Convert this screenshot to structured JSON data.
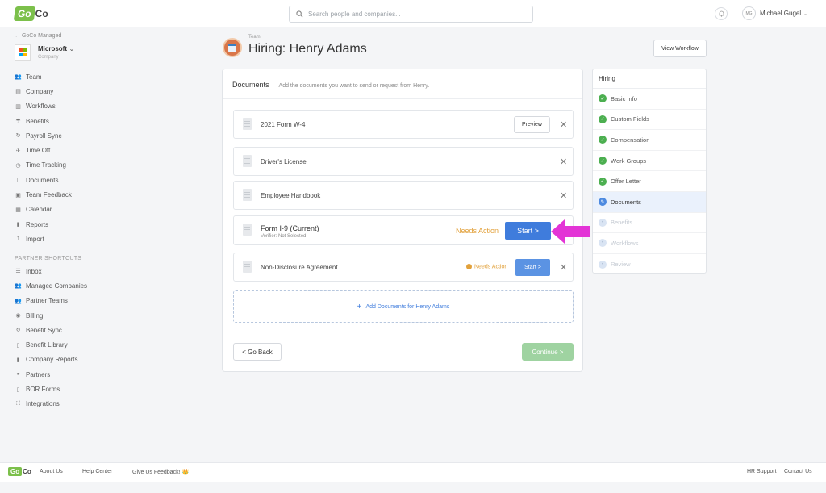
{
  "header": {
    "logo_go": "Go",
    "logo_co": "Co",
    "search_placeholder": "Search people and companies...",
    "user_initials": "MG",
    "user_name": "Michael Gugel"
  },
  "sidebar": {
    "back_label": "← GoCo Managed",
    "company_name": "Microsoft",
    "company_type": "Company",
    "items": [
      {
        "label": "Team",
        "icon": "people-icon"
      },
      {
        "label": "Company",
        "icon": "building-icon"
      },
      {
        "label": "Workflows",
        "icon": "workflow-icon"
      },
      {
        "label": "Benefits",
        "icon": "umbrella-icon"
      },
      {
        "label": "Payroll Sync",
        "icon": "sync-icon"
      },
      {
        "label": "Time Off",
        "icon": "plane-icon"
      },
      {
        "label": "Time Tracking",
        "icon": "clock-icon"
      },
      {
        "label": "Documents",
        "icon": "document-icon"
      },
      {
        "label": "Team Feedback",
        "icon": "feedback-icon"
      },
      {
        "label": "Calendar",
        "icon": "calendar-icon"
      },
      {
        "label": "Reports",
        "icon": "chart-icon"
      },
      {
        "label": "Import",
        "icon": "upload-icon"
      }
    ],
    "partner_header": "PARTNER SHORTCUTS",
    "partner_items": [
      {
        "label": "Inbox",
        "icon": "inbox-icon"
      },
      {
        "label": "Managed Companies",
        "icon": "people-icon"
      },
      {
        "label": "Partner Teams",
        "icon": "people-icon"
      },
      {
        "label": "Billing",
        "icon": "billing-icon"
      },
      {
        "label": "Benefit Sync",
        "icon": "sync-icon"
      },
      {
        "label": "Benefit Library",
        "icon": "document-icon"
      },
      {
        "label": "Company Reports",
        "icon": "chart-icon"
      },
      {
        "label": "Partners",
        "icon": "handshake-icon"
      },
      {
        "label": "BOR Forms",
        "icon": "document-icon"
      },
      {
        "label": "Integrations",
        "icon": "integrations-icon"
      }
    ]
  },
  "page": {
    "breadcrumb": "Team",
    "title": "Hiring: Henry Adams",
    "view_workflow": "View Workflow"
  },
  "documents": {
    "title": "Documents",
    "description": "Add the documents you want to send or request from Henry.",
    "rows": [
      {
        "name": "2021 Form W-4",
        "action": "Preview"
      },
      {
        "name": "Driver's License"
      },
      {
        "name": "Employee Handbook"
      },
      {
        "name": "Form I-9 (Current)",
        "sub": "Verifier: Not Selected",
        "status": "Needs Action",
        "action": "Start >"
      },
      {
        "name": "Non-Disclosure Agreement",
        "status": "Needs Action",
        "action": "Start >"
      }
    ],
    "add_label": "Add Documents for  Henry Adams",
    "back_label": "< Go Back",
    "continue_label": "Continue >"
  },
  "steps": {
    "title": "Hiring",
    "items": [
      {
        "label": "Basic Info",
        "state": "done"
      },
      {
        "label": "Custom Fields",
        "state": "done"
      },
      {
        "label": "Compensation",
        "state": "done"
      },
      {
        "label": "Work Groups",
        "state": "done"
      },
      {
        "label": "Offer Letter",
        "state": "done"
      },
      {
        "label": "Documents",
        "state": "current"
      },
      {
        "label": "Benefits",
        "state": "todo"
      },
      {
        "label": "Workflows",
        "state": "todo"
      },
      {
        "label": "Review",
        "state": "todo"
      }
    ]
  },
  "footer": {
    "about": "About Us",
    "help": "Help Center",
    "feedback": "Give Us Feedback! 👑",
    "hr_support": "HR Support",
    "contact": "Contact Us"
  },
  "colors": {
    "brand_green": "#7cc04b",
    "primary_blue": "#3f7cdc",
    "warning": "#e2a13b",
    "arrow": "#e334d6"
  }
}
